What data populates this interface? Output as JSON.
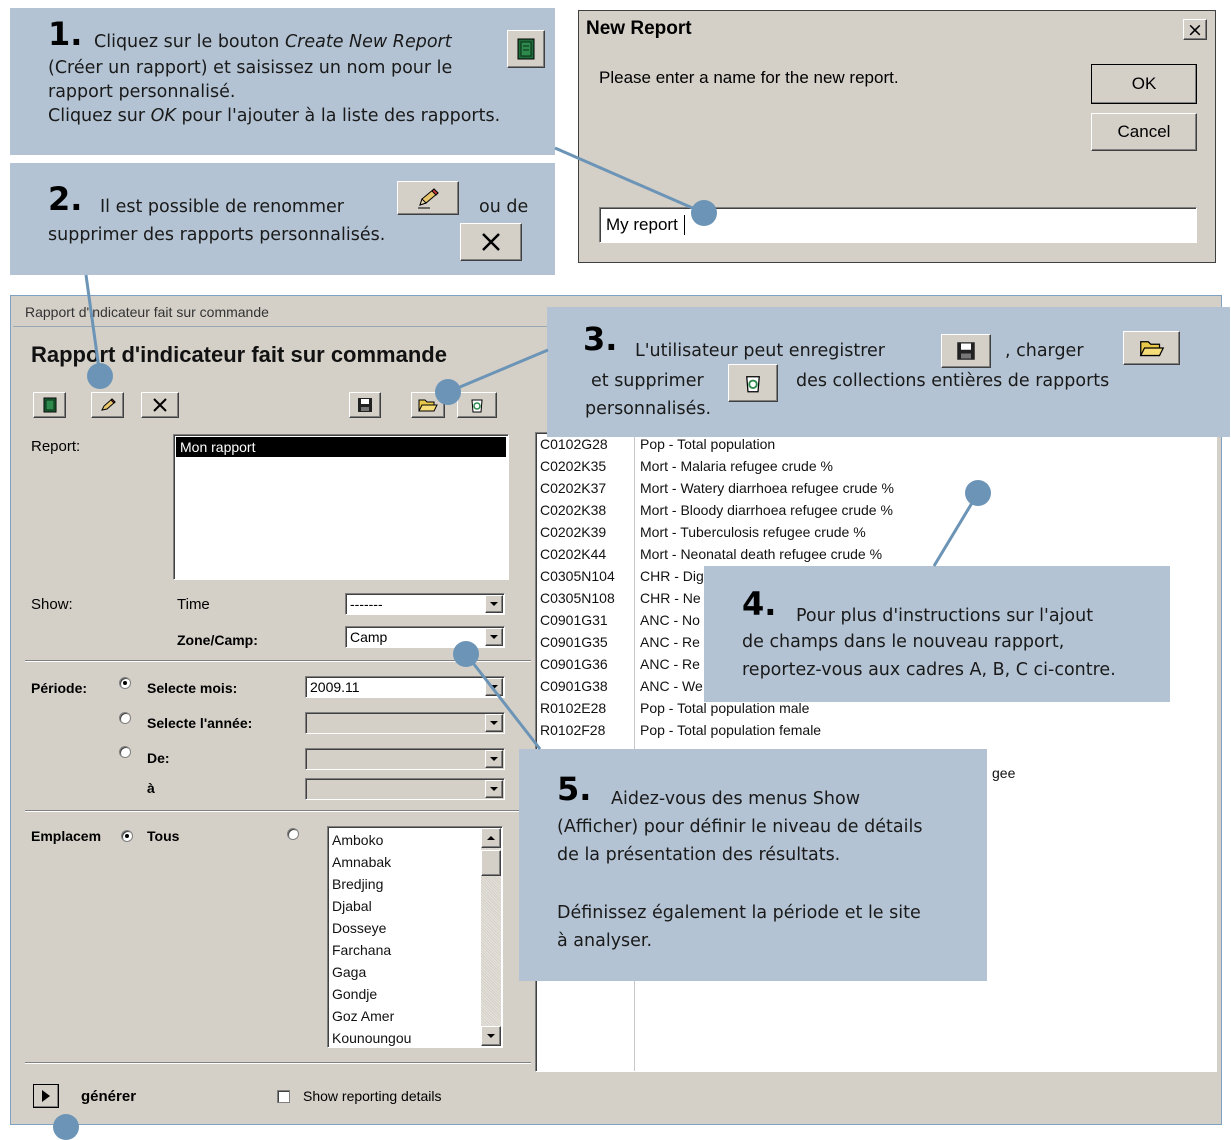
{
  "callout1": {
    "number": "1.",
    "text_a": "Cliquez sur le bouton ",
    "text_em": "Create New Report",
    "line2": "(Créer un rapport) et saisissez un nom pour le",
    "line3": "rapport personnalisé.",
    "line4_a": "Cliquez sur ",
    "line4_em": "OK",
    "line4_b": " pour l'ajouter à la liste des rapports."
  },
  "callout2": {
    "number": "2.",
    "text_a": "Il est possible de renommer",
    "text_b": "ou de",
    "line2": "supprimer des rapports personnalisés."
  },
  "callout3": {
    "number": "3.",
    "text_a": "L'utilisateur peut enregistrer",
    "text_b": ", charger",
    "line2_a": "et supprimer",
    "line2_b": "des collections entières de rapports",
    "line3": "personnalisés."
  },
  "callout4": {
    "number": "4.",
    "line1": "Pour plus d'instructions sur l'ajout",
    "line2": "de champs dans le nouveau rapport,",
    "line3": "reportez-vous aux cadres A, B, C ci-contre."
  },
  "callout5": {
    "number": "5.",
    "line1": "Aidez-vous des menus Show",
    "line2": "(Afficher) pour définir le niveau de détails",
    "line3": "de la présentation des résultats.",
    "line4": "Définissez également la période et le site",
    "line5": "à analyser."
  },
  "dialog": {
    "title": "New Report",
    "close": "×",
    "prompt": "Please enter a name for the new report.",
    "ok_label": "OK",
    "cancel_label": "Cancel",
    "input_value": "My report"
  },
  "main_window": {
    "caption": "Rapport d'indicateur fait sur commande",
    "heading": "Rapport d'indicateur fait sur commande",
    "report_label": "Report:",
    "report_items": [
      "Mon rapport"
    ],
    "show_label": "Show:",
    "time_label": "Time",
    "time_value": "-------",
    "zone_label": "Zone/Camp:",
    "zone_value": "Camp",
    "periode_label": "Période:",
    "option_mois": "Selecte mois:",
    "mois_value": "2009.11",
    "option_annee": "Selecte l'année:",
    "option_de": "De:",
    "a_label": "à",
    "emplacement_label": "Emplacem",
    "tous_label": "Tous",
    "locations": [
      "Amboko",
      "Amnabak",
      "Bredjing",
      "Djabal",
      "Dosseye",
      "Farchana",
      "Gaga",
      "Gondje",
      "Goz Amer",
      "Kounoungou"
    ],
    "generate_label": "générer",
    "show_details_label": "Show reporting details",
    "indicators": [
      {
        "code": "C0102G28",
        "name": "Pop - Total population"
      },
      {
        "code": "C0202K35",
        "name": "Mort - Malaria refugee crude %"
      },
      {
        "code": "C0202K37",
        "name": "Mort - Watery diarrhoea refugee crude %"
      },
      {
        "code": "C0202K38",
        "name": "Mort - Bloody diarrhoea refugee crude %"
      },
      {
        "code": "C0202K39",
        "name": "Mort - Tuberculosis refugee crude %"
      },
      {
        "code": "C0202K44",
        "name": "Mort - Neonatal death refugee crude %"
      },
      {
        "code": "C0305N104",
        "name": "CHR - Dig"
      },
      {
        "code": "C0305N108",
        "name": "CHR - Ne"
      },
      {
        "code": "C0901G31",
        "name": "ANC - No"
      },
      {
        "code": "C0901G35",
        "name": "ANC - Re"
      },
      {
        "code": "C0901G36",
        "name": "ANC - Re"
      },
      {
        "code": "C0901G38",
        "name": "ANC - We"
      },
      {
        "code": "R0102E28",
        "name": "Pop - Total population male"
      },
      {
        "code": "R0102F28",
        "name": "Pop - Total population female"
      }
    ],
    "partial_row_tail": "gee"
  }
}
